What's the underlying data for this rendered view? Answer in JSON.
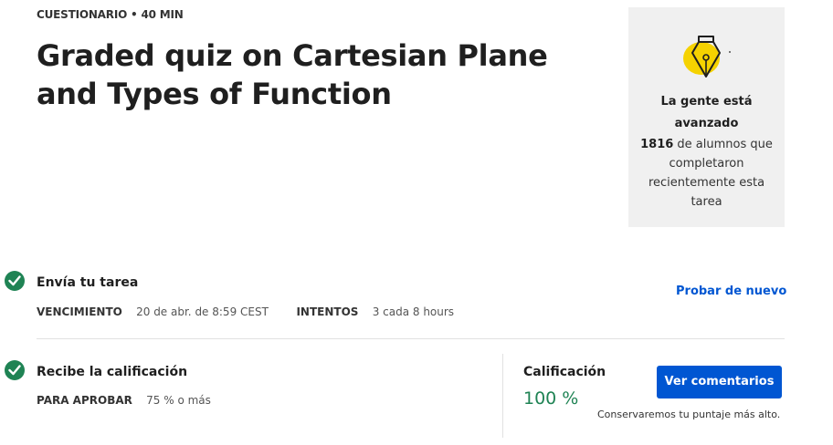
{
  "header": {
    "meta": "CUESTIONARIO • 40 MIN",
    "title": "Graded quiz on Cartesian Plane and Types of Function"
  },
  "panel": {
    "heading": "La gente está avanzado",
    "count": "1816",
    "body": " de alumnos que completaron recientemente esta tarea",
    "icon": "pen-nib-icon",
    "accent": "#f5d200"
  },
  "submit": {
    "title": "Envía tu tarea",
    "due_label": "VENCIMIENTO",
    "due_value": "20 de abr. de 8:59 CEST",
    "attempts_label": "INTENTOS",
    "attempts_value": "3 cada 8 hours",
    "retry_link": "Probar de nuevo"
  },
  "grade": {
    "title": "Recibe la calificación",
    "pass_label": "PARA APROBAR",
    "pass_value": "75 % o más",
    "grade_label": "Calificación",
    "grade_value": "100 %",
    "feedback_button": "Ver comentarios",
    "keep_note": "Conservaremos tu puntaje más alto."
  },
  "colors": {
    "success": "#1f8354",
    "primary": "#0056d2",
    "panel_bg": "#f0f0f0"
  }
}
